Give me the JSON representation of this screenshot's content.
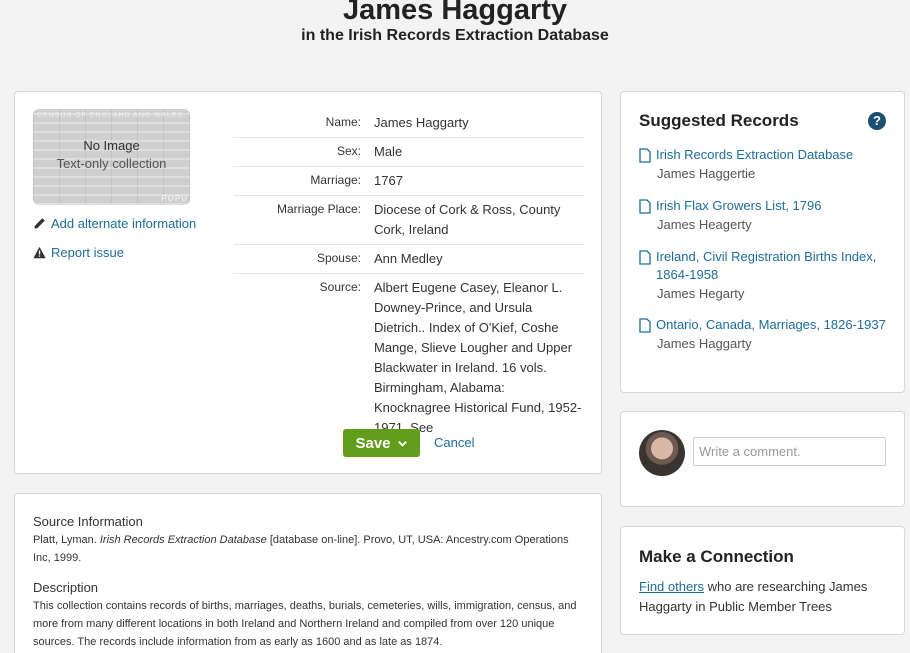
{
  "header": {
    "title": "James Haggarty",
    "subtitle": "in the Irish Records Extraction Database"
  },
  "thumbnail": {
    "census_text": "CENSUS OF ENGLAND AND WALES,",
    "popu_text": "POPU",
    "no_image": "No Image",
    "text_only": "Text-only collection"
  },
  "actions": {
    "add_alternate": "Add alternate information",
    "report_issue": "Report issue",
    "save": "Save",
    "cancel": "Cancel"
  },
  "facts": [
    {
      "label": "Name:",
      "value": "James Haggarty"
    },
    {
      "label": "Sex:",
      "value": "Male"
    },
    {
      "label": "Marriage:",
      "value": "1767"
    },
    {
      "label": "Marriage Place:",
      "value": "Diocese of Cork & Ross, County Cork, Ireland"
    },
    {
      "label": "Spouse:",
      "value": "Ann Medley"
    },
    {
      "label": "Source:",
      "value": "Albert Eugene Casey, Eleanor L. Downey-Prince, and Ursula Dietrich.. Index of O'Kief, Coshe Mange, Slieve Lougher and Upper Blackwater in Ireland. 16 vols. Birmingham, Alabama: Knocknagree Historical Fund, 1952-1971. See"
    }
  ],
  "source_info": {
    "heading": "Source Information",
    "text_before": "Platt, Lyman. ",
    "text_italic": "Irish Records Extraction Database",
    "text_after": " [database on-line]. Provo, UT, USA: Ancestry.com Operations Inc, 1999.",
    "description_heading": "Description",
    "description_text": "This collection contains records of births, marriages, deaths, burials, cemeteries, wills, immigration, census, and more from many different locations in both Ireland and Northern Ireland and compiled from over 120 unique sources. The records include information from as early as 1600 and as late as 1874."
  },
  "suggested": {
    "title": "Suggested Records",
    "help": "?",
    "records": [
      {
        "title": "Irish Records Extraction Database",
        "name": "James Haggertie"
      },
      {
        "title": "Irish Flax Growers List, 1796",
        "name": "James Heagerty"
      },
      {
        "title": "Ireland, Civil Registration Births Index, 1864-1958",
        "name": "James Hegarty"
      },
      {
        "title": "Ontario, Canada, Marriages, 1826-1937",
        "name": "James Haggarty"
      }
    ]
  },
  "comment": {
    "placeholder": "Write a comment."
  },
  "connection": {
    "title": "Make a Connection",
    "link": "Find others",
    "text": " who are researching James Haggarty in Public Member Trees"
  },
  "colors": {
    "link": "#1d6c99",
    "save_button": "#5f9d1a",
    "help_icon": "#1b4f72"
  }
}
